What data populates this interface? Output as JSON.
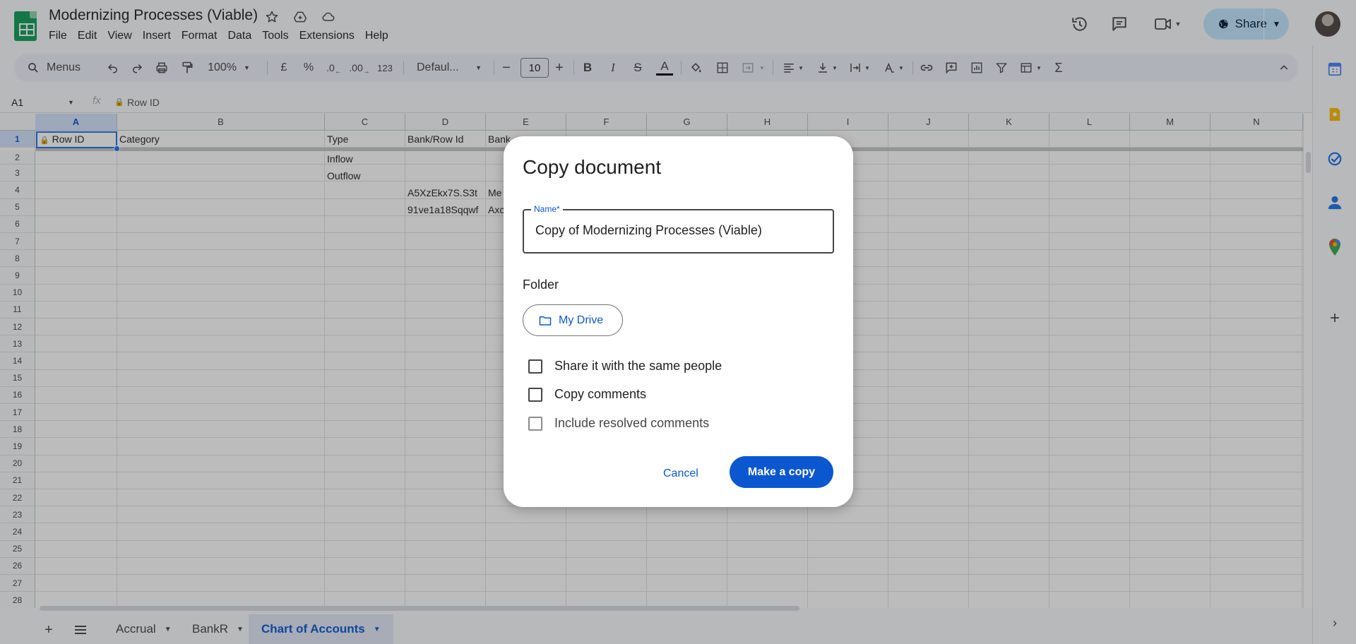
{
  "app": {
    "doc_title": "Modernizing Processes (Viable)",
    "menu": [
      "File",
      "Edit",
      "View",
      "Insert",
      "Format",
      "Data",
      "Tools",
      "Extensions",
      "Help"
    ],
    "share_label": "Share"
  },
  "toolbar": {
    "menus_label": "Menus",
    "zoom": "100%",
    "currency": "£",
    "percent": "%",
    "dec_decrease": ".0",
    "dec_increase": ".00",
    "number_format": "123",
    "font": "Defaul...",
    "font_size": "10"
  },
  "formula_bar": {
    "name_box": "A1",
    "fx": "fx",
    "value": "Row ID"
  },
  "grid": {
    "columns": [
      "A",
      "B",
      "C",
      "D",
      "E",
      "F",
      "G",
      "H",
      "I",
      "J",
      "K",
      "L",
      "M",
      "N"
    ],
    "rows": [
      "1",
      "2",
      "3",
      "4",
      "5",
      "6",
      "7",
      "8",
      "9",
      "10",
      "11",
      "12",
      "13",
      "14",
      "15",
      "16",
      "17",
      "18",
      "19",
      "20",
      "21",
      "22",
      "23",
      "24",
      "25",
      "26",
      "27",
      "28"
    ],
    "header_row": {
      "a": "Row ID",
      "b": "Category",
      "c": "Type",
      "d": "Bank/Row Id",
      "e": "Bank"
    },
    "c2": "Inflow",
    "c3": "Outflow",
    "d4": "A5XzEkx7S.S3t",
    "e4": "Me",
    "d5": "91ve1a18Sqqwf",
    "e5": "Axc"
  },
  "sheets": [
    {
      "label": "Accrual"
    },
    {
      "label": "BankR"
    },
    {
      "label": "Chart of Accounts"
    }
  ],
  "dialog": {
    "title": "Copy document",
    "name_label": "Name*",
    "name_value": "Copy of Modernizing Processes (Viable)",
    "folder_label": "Folder",
    "folder_button": "My Drive",
    "share_same_people": "Share it with the same people",
    "copy_comments": "Copy comments",
    "include_resolved": "Include resolved comments",
    "cancel": "Cancel",
    "make_copy": "Make a copy"
  },
  "colors": {
    "accent": "#0b57d0",
    "share_bg": "#c2e7ff",
    "sheets_green": "#0f9d58"
  }
}
